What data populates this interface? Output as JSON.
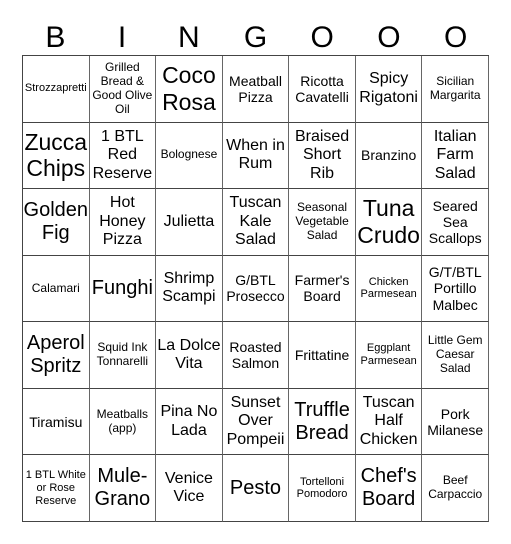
{
  "header": {
    "letters": [
      "B",
      "I",
      "N",
      "G",
      "O",
      "O",
      "O"
    ]
  },
  "cells": [
    [
      "Strozzapretti",
      "Grilled Bread & Good Olive Oil",
      "Coco Rosa",
      "Meatball Pizza",
      "Ricotta Cavatelli",
      "Spicy Rigatoni",
      "Sicilian Margarita"
    ],
    [
      "Zucca Chips",
      "1 BTL Red Reserve",
      "Bolognese",
      "When in Rum",
      "Braised Short Rib",
      "Branzino",
      "Italian Farm Salad"
    ],
    [
      "Golden Fig",
      "Hot Honey Pizza",
      "Julietta",
      "Tuscan Kale Salad",
      "Seasonal Vegetable Salad",
      "Tuna Crudo",
      "Seared Sea Scallops"
    ],
    [
      "Calamari",
      "Funghi",
      "Shrimp Scampi",
      "G/BTL Prosecco",
      "Farmer's Board",
      "Chicken Parmesean",
      "G/T/BTL Portillo Malbec"
    ],
    [
      "Aperol Spritz",
      "Squid Ink Tonnarelli",
      "La Dolce Vita",
      "Roasted Salmon",
      "Frittatine",
      "Eggplant Parmesean",
      "Little Gem Caesar Salad"
    ],
    [
      "Tiramisu",
      "Meatballs (app)",
      "Pina No Lada",
      "Sunset Over Pompeii",
      "Truffle Bread",
      "Tuscan Half Chicken",
      "Pork Milanese"
    ],
    [
      "1 BTL White or Rose Reserve",
      "Mule-Grano",
      "Venice Vice",
      "Pesto",
      "Tortelloni Pomodoro",
      "Chef's Board",
      "Beef Carpaccio"
    ]
  ]
}
